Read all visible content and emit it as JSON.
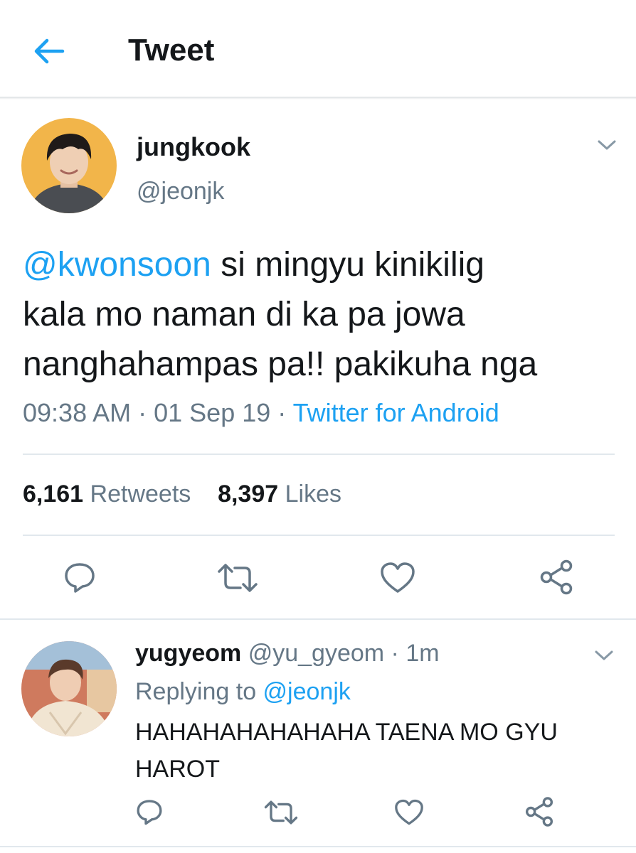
{
  "header": {
    "title": "Tweet",
    "back_icon": "arrow-left-icon"
  },
  "colors": {
    "accent": "#1da1f2",
    "muted": "#657786",
    "text": "#14171a",
    "divider": "#e1e8ed"
  },
  "tweet": {
    "author_name": "jungkook",
    "author_handle": "@jeonjk",
    "mention": "@kwonsoon",
    "body_line1": " si mingyu kinikilig",
    "body_line2": "kala mo naman di ka pa jowa",
    "body_line3": "nanghahampas pa!! pakikuha nga",
    "time": "09:38 AM",
    "sep1": " · ",
    "date": "01 Sep 19",
    "sep2": " · ",
    "source": "Twitter for Android",
    "retweet_count": "6,161",
    "retweet_label": "Retweets",
    "like_count": "8,397",
    "like_label": "Likes"
  },
  "reply": {
    "author_name": "yugyeom",
    "author_handle": "@yu_gyeom",
    "sep": " · ",
    "age": "1m",
    "replying_prefix": "Replying to ",
    "replying_to": "@jeonjk",
    "body_line1": "HAHAHAHAHAHAHA TAENA MO GYU",
    "body_line2": "HAROT"
  },
  "icons": [
    "reply-icon",
    "retweet-icon",
    "like-icon",
    "share-icon",
    "chevron-down-icon"
  ]
}
